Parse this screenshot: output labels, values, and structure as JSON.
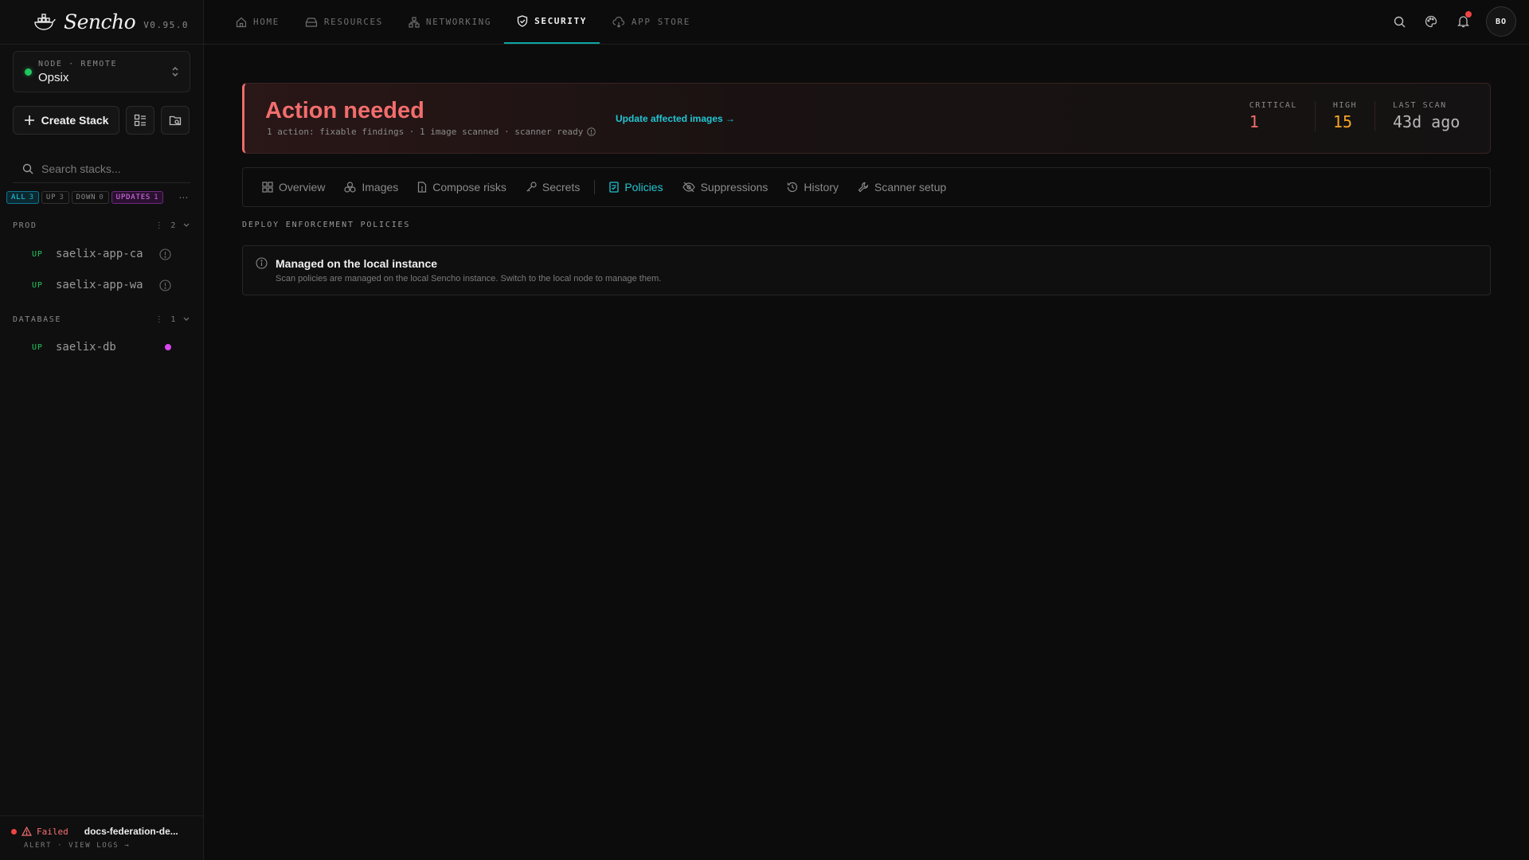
{
  "brand": {
    "name": "Sencho",
    "version": "V0.95.0"
  },
  "node": {
    "sub_label": "NODE · REMOTE",
    "name": "Opsix",
    "status_color": "#22c55e"
  },
  "sidebar": {
    "create_label": "Create Stack",
    "search_placeholder": "Search stacks...",
    "filters": [
      {
        "label": "ALL",
        "count": "3"
      },
      {
        "label": "UP",
        "count": "3"
      },
      {
        "label": "DOWN",
        "count": "0"
      },
      {
        "label": "UPDATES",
        "count": "1"
      }
    ],
    "more": "⋯",
    "groups": [
      {
        "label": "PROD",
        "count": "2",
        "items": [
          {
            "status": "UP",
            "name": "saelix-app-ca",
            "indicator": "info-icon"
          },
          {
            "status": "UP",
            "name": "saelix-app-wa",
            "indicator": "info-icon"
          }
        ]
      },
      {
        "label": "DATABASE",
        "count": "1",
        "items": [
          {
            "status": "UP",
            "name": "saelix-db",
            "indicator": "update-dot"
          }
        ]
      }
    ],
    "alert": {
      "status": "Failed",
      "title": "docs-federation-de...",
      "sub": "ALERT · VIEW LOGS →"
    }
  },
  "topnav": {
    "tabs": [
      {
        "label": "HOME",
        "icon": "home-icon"
      },
      {
        "label": "RESOURCES",
        "icon": "drive-icon"
      },
      {
        "label": "NETWORKING",
        "icon": "network-icon"
      },
      {
        "label": "SECURITY",
        "icon": "shield-icon",
        "active": true
      },
      {
        "label": "APP STORE",
        "icon": "cloud-download-icon"
      }
    ],
    "avatar": "BO"
  },
  "banner": {
    "title": "Action needed",
    "subtitle": "1 action: fixable findings · 1 image scanned · scanner ready",
    "link": "Update affected images →",
    "stats": [
      {
        "label": "CRITICAL",
        "value": "1",
        "color": "#f26d6d"
      },
      {
        "label": "HIGH",
        "value": "15",
        "color": "#f5a524"
      },
      {
        "label": "LAST SCAN",
        "value": "43d ago",
        "color": "#b8b8b8"
      }
    ]
  },
  "tabs": [
    {
      "label": "Overview",
      "icon": "grid-icon"
    },
    {
      "label": "Images",
      "icon": "layers-icon"
    },
    {
      "label": "Compose risks",
      "icon": "file-icon"
    },
    {
      "label": "Secrets",
      "icon": "key-icon"
    },
    {
      "label": "Policies",
      "icon": "policy-icon",
      "active": true
    },
    {
      "label": "Suppressions",
      "icon": "eye-off-icon"
    },
    {
      "label": "History",
      "icon": "history-icon"
    },
    {
      "label": "Scanner setup",
      "icon": "wrench-icon"
    }
  ],
  "section": {
    "label": "DEPLOY ENFORCEMENT POLICIES",
    "card_title": "Managed on the local instance",
    "card_text": "Scan policies are managed on the local Sencho instance. Switch to the local node to manage them."
  }
}
